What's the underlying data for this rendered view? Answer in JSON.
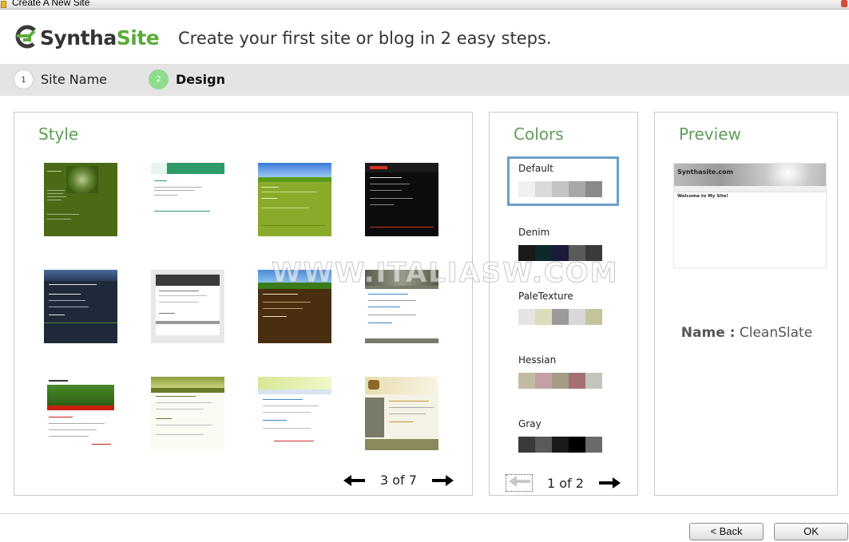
{
  "window": {
    "title": "Create A New Site"
  },
  "header": {
    "logo_part1": "Syntha",
    "logo_part2": "Site",
    "tagline": "Create your first site or blog in 2 easy steps."
  },
  "steps": [
    {
      "number": "1",
      "label": "Site Name"
    },
    {
      "number": "2",
      "label": "Design"
    }
  ],
  "style_panel": {
    "title": "Style",
    "pager": "3 of 7"
  },
  "colors_panel": {
    "title": "Colors",
    "pager": "1 of 2",
    "schemes": [
      {
        "name": "Default",
        "selected": true,
        "swatches": [
          "#f0f0f0",
          "#dadada",
          "#c4c4c4",
          "#a8a8a8",
          "#8a8a8a"
        ]
      },
      {
        "name": "Denim",
        "selected": false,
        "swatches": [
          "#1a1a1a",
          "#0c2a2a",
          "#1c1a3a",
          "#5a5a5a",
          "#3a3a3a"
        ]
      },
      {
        "name": "PaleTexture",
        "selected": false,
        "swatches": [
          "#e4e4e4",
          "#dcdcb8",
          "#9a9a9a",
          "#d8d8d8",
          "#c4c49c"
        ]
      },
      {
        "name": "Hessian",
        "selected": false,
        "swatches": [
          "#c0bca4",
          "#c4a0a4",
          "#a49c84",
          "#a47074",
          "#c4c4bc"
        ]
      },
      {
        "name": "Gray",
        "selected": false,
        "swatches": [
          "#3a3a3a",
          "#5a5a5a",
          "#1a1a1a",
          "#000000",
          "#6a6a6a"
        ]
      }
    ]
  },
  "preview_panel": {
    "title": "Preview",
    "name_label": "Name :",
    "name_value": "CleanSlate",
    "preview_site_title": "Synthasite.com",
    "preview_heading": "Welcome to My Site!"
  },
  "watermark": "WWW.ITALIASW.COM",
  "buttons": {
    "back": "< Back",
    "ok": "OK"
  }
}
